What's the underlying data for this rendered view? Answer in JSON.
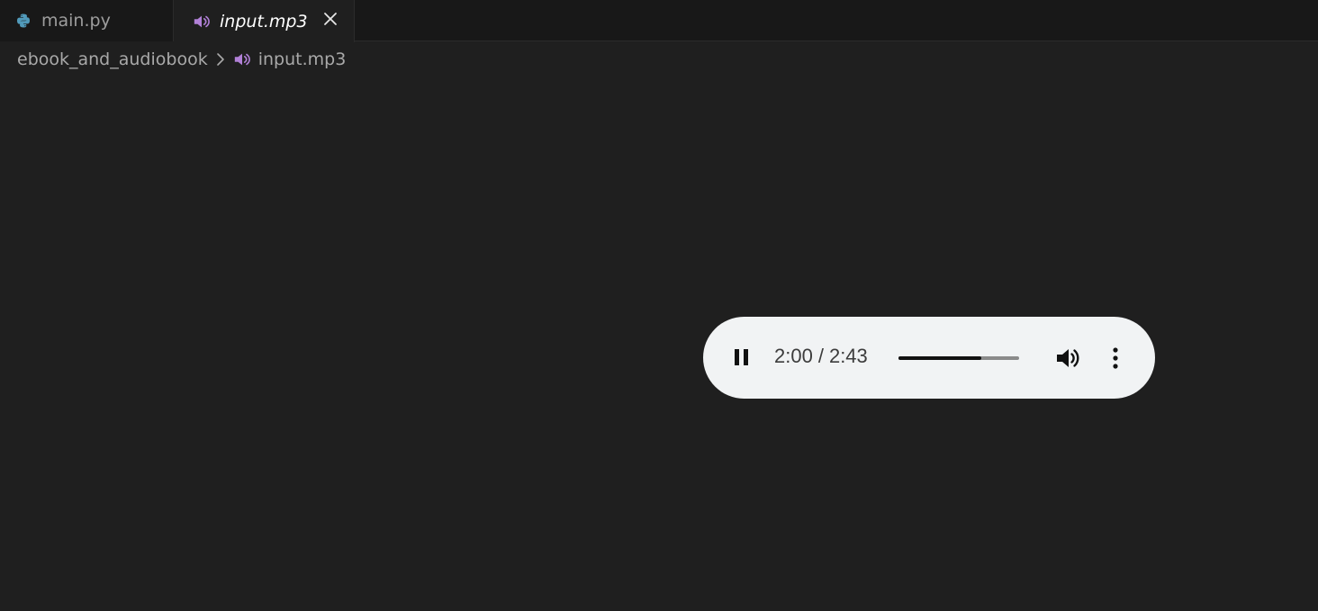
{
  "tabs": [
    {
      "label": "main.py",
      "icon": "python-file-icon",
      "active": false
    },
    {
      "label": "input.mp3",
      "icon": "audio-file-icon",
      "active": true
    }
  ],
  "breadcrumb": {
    "folder": "ebook_and_audiobook",
    "file": "input.mp3"
  },
  "player": {
    "current_time": "2:00",
    "separator": "/",
    "duration": "2:43",
    "progress_fraction": 0.69,
    "state": "playing"
  },
  "colors": {
    "audio_icon": "#b180d7",
    "python_icon": "#519aba",
    "player_bg": "#f1f3f4",
    "editor_bg": "#1f1f1f"
  }
}
